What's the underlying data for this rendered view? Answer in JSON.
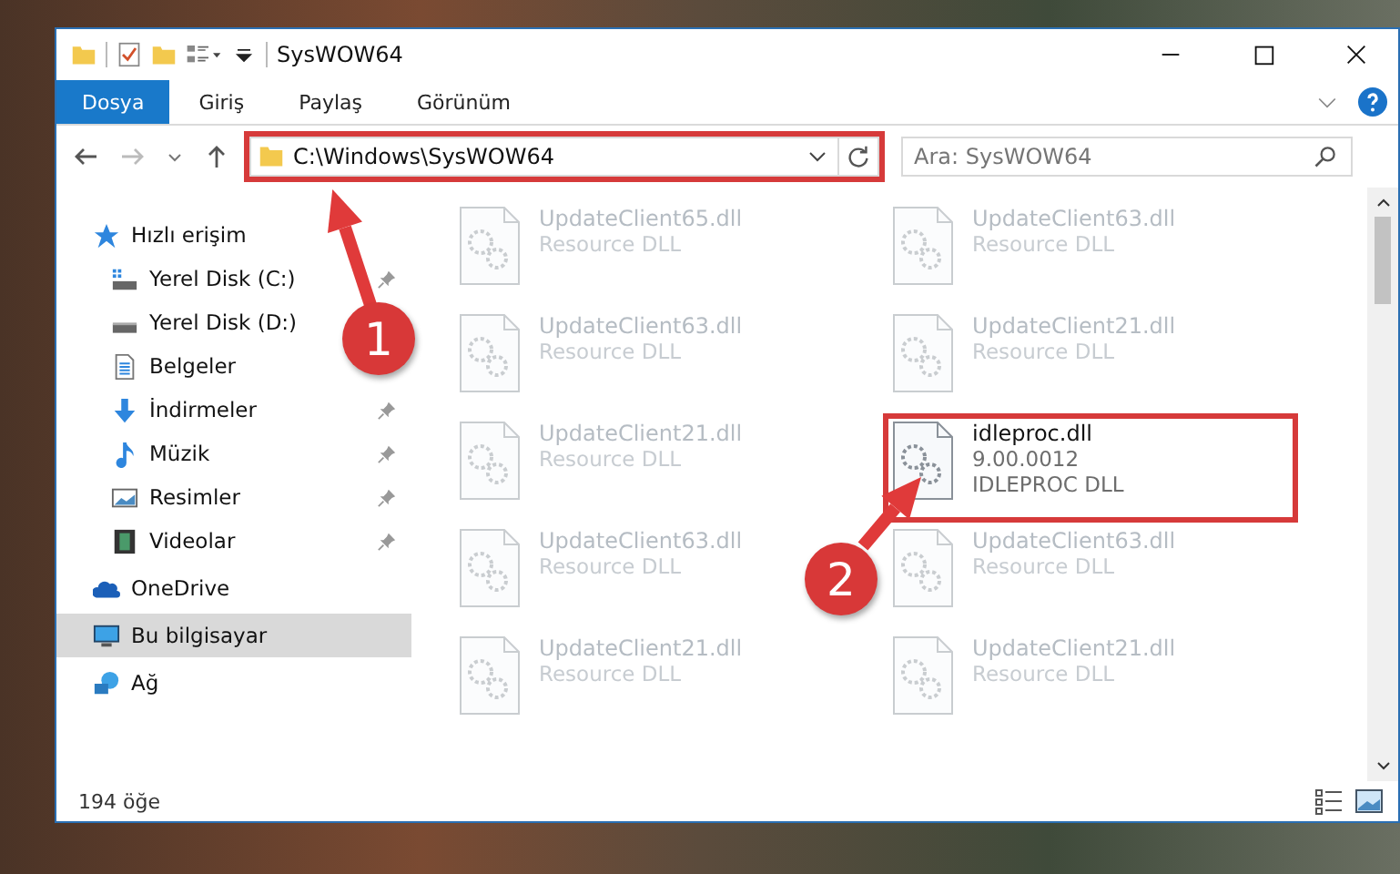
{
  "window": {
    "title": "SysWOW64"
  },
  "ribbon_tabs": [
    {
      "label": "Dosya",
      "selected": true
    },
    {
      "label": "Giriş",
      "selected": false
    },
    {
      "label": "Paylaş",
      "selected": false
    },
    {
      "label": "Görünüm",
      "selected": false
    }
  ],
  "address_bar": {
    "path": "C:\\Windows\\SysWOW64",
    "highlighted": true
  },
  "search": {
    "placeholder": "Ara: SysWOW64"
  },
  "sidebar": {
    "items": [
      {
        "label": "Hızlı erişim",
        "kind": "star",
        "selected": false,
        "children": [
          {
            "label": "Yerel Disk (C:)",
            "kind": "drive-c",
            "selected": false,
            "pinned": true
          },
          {
            "label": "Yerel Disk (D:)",
            "kind": "drive",
            "selected": false,
            "pinned": false
          },
          {
            "label": "Belgeler",
            "kind": "document",
            "selected": false,
            "pinned": false
          },
          {
            "label": "İndirmeler",
            "kind": "download",
            "selected": false,
            "pinned": true
          },
          {
            "label": "Müzik",
            "kind": "music",
            "selected": false,
            "pinned": true
          },
          {
            "label": "Resimler",
            "kind": "picture",
            "selected": false,
            "pinned": true
          },
          {
            "label": "Videolar",
            "kind": "video",
            "selected": false,
            "pinned": true
          }
        ]
      },
      {
        "label": "OneDrive",
        "kind": "cloud",
        "selected": false
      },
      {
        "label": "Bu bilgisayar",
        "kind": "computer",
        "selected": true
      },
      {
        "label": "Ağ",
        "kind": "network",
        "selected": false
      }
    ]
  },
  "files": [
    {
      "name": "UpdateClient65.dll",
      "lines": [
        "Resource DLL"
      ],
      "blurred": true,
      "highlighted": false
    },
    {
      "name": "UpdateClient63.dll",
      "lines": [
        "Resource DLL"
      ],
      "blurred": true,
      "highlighted": false
    },
    {
      "name": "UpdateClient63.dll",
      "lines": [
        "Resource DLL"
      ],
      "blurred": true,
      "highlighted": false
    },
    {
      "name": "UpdateClient21.dll",
      "lines": [
        "Resource DLL"
      ],
      "blurred": true,
      "highlighted": false
    },
    {
      "name": "UpdateClient21.dll",
      "lines": [
        "Resource DLL"
      ],
      "blurred": true,
      "highlighted": false
    },
    {
      "name": "idleproc.dll",
      "lines": [
        "9.00.0012",
        "IDLEPROC DLL"
      ],
      "blurred": false,
      "highlighted": true
    },
    {
      "name": "UpdateClient63.dll",
      "lines": [
        "Resource DLL"
      ],
      "blurred": true,
      "highlighted": false
    },
    {
      "name": "UpdateClient63.dll",
      "lines": [
        "Resource DLL"
      ],
      "blurred": true,
      "highlighted": false
    },
    {
      "name": "UpdateClient21.dll",
      "lines": [
        "Resource DLL"
      ],
      "blurred": true,
      "highlighted": false
    },
    {
      "name": "UpdateClient21.dll",
      "lines": [
        "Resource DLL"
      ],
      "blurred": true,
      "highlighted": false
    }
  ],
  "status_bar": {
    "item_count": "194 öğe"
  },
  "annotations": [
    {
      "label": "1"
    },
    {
      "label": "2"
    }
  ]
}
